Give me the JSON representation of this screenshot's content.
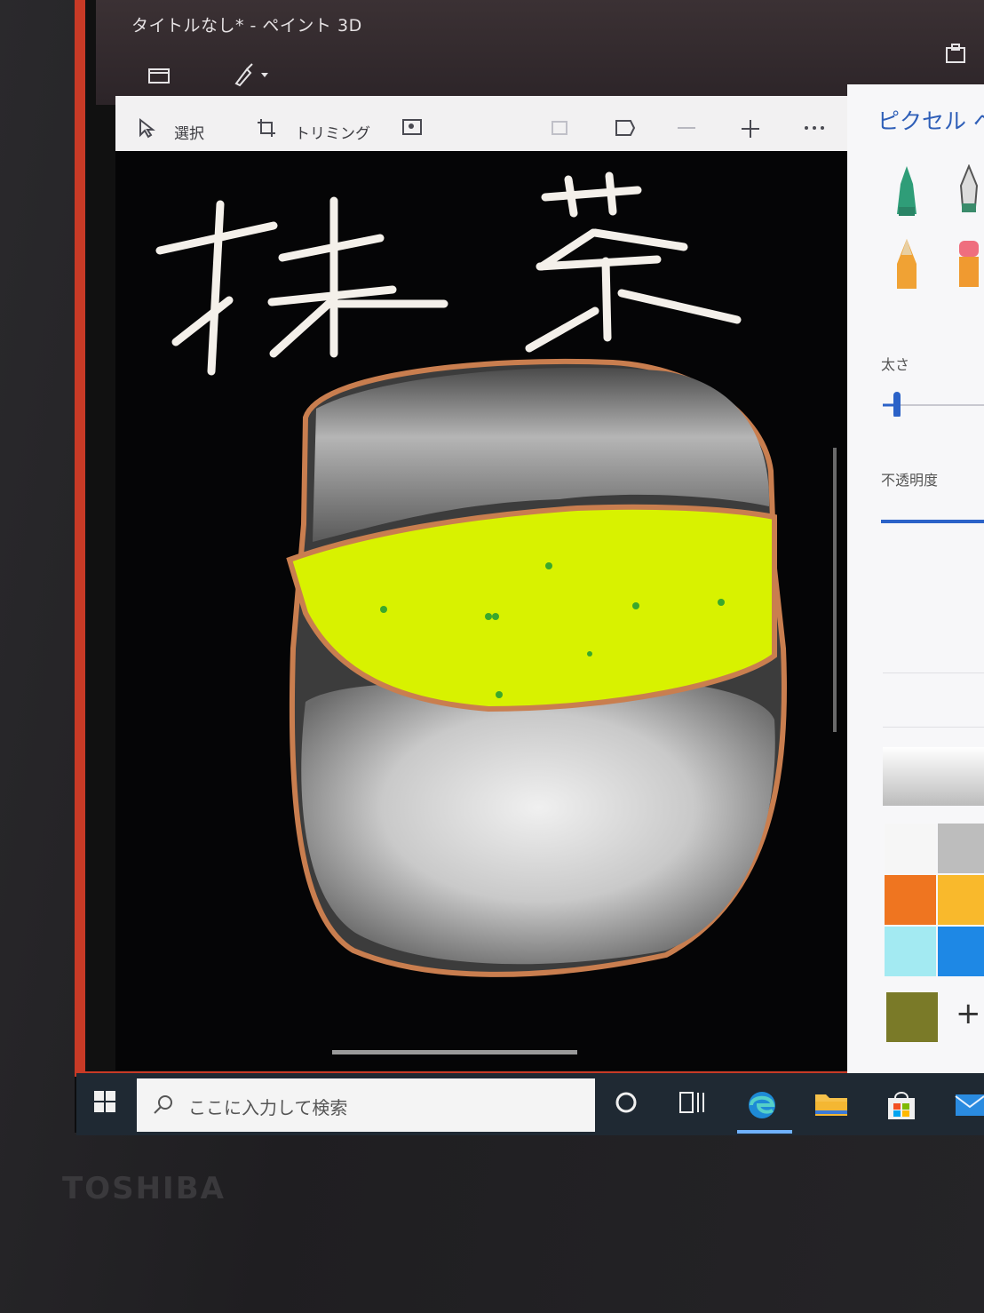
{
  "window": {
    "title": "タイトルなし* - ペイント 3D"
  },
  "toolbar": {
    "select_label": "選択",
    "crop_label": "トリミング"
  },
  "canvas": {
    "handwritten_text": "抹茶"
  },
  "side_panel": {
    "title": "ピクセル ペン",
    "thickness_label": "太さ",
    "thickness_level": 0.1,
    "opacity_label": "不透明度",
    "add_color_label": "+"
  },
  "palette": {
    "colors": [
      "#f6f6f6",
      "#bdbdbd",
      "#ef7520",
      "#f9b92c",
      "#a3eaf2",
      "#1e88e5"
    ],
    "custom_color": "#7a7a28"
  },
  "taskbar": {
    "search_placeholder": "ここに入力して検索",
    "icons": [
      "windows-icon",
      "cortana-icon",
      "task-view-icon",
      "edge-icon",
      "file-explorer-icon",
      "store-icon",
      "mail-icon"
    ]
  },
  "device": {
    "brand": "TOSHIBA"
  }
}
